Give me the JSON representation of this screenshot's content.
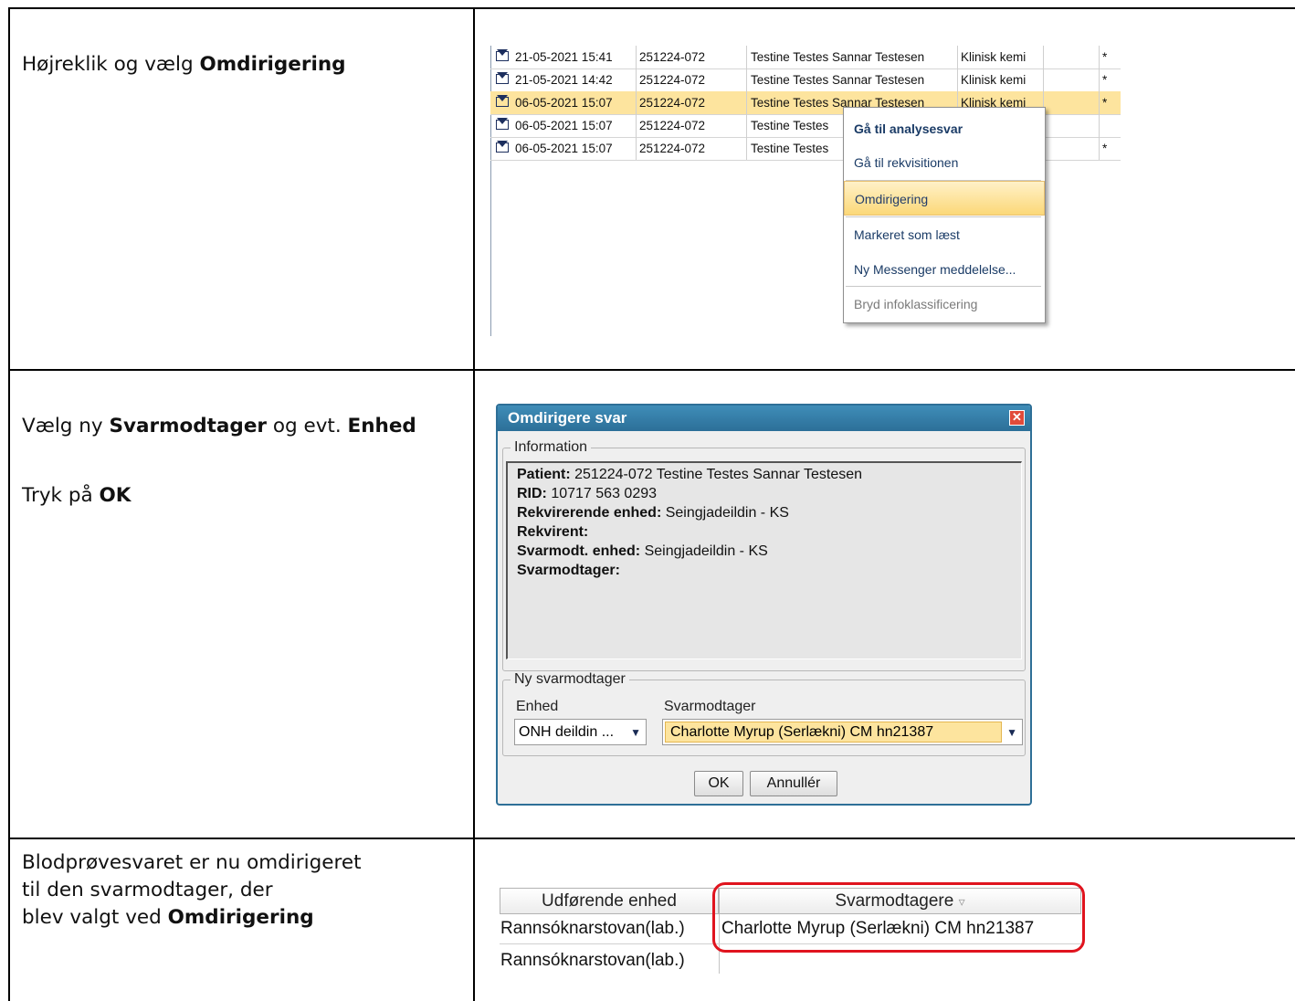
{
  "step1": {
    "text": "Højreklik og vælg ",
    "bold": "Omdirigering"
  },
  "step2": {
    "line1_a": "Vælg ny ",
    "line1_b": "Svarmodtager",
    "line1_c": " og evt. ",
    "line1_d": "Enhed",
    "line2_a": "Tryk på ",
    "line2_b": "OK"
  },
  "step3": {
    "line1": "Blodprøvesvaret er nu omdirigeret",
    "line2": "til den svarmodtager, der",
    "line3_a": "blev valgt ved ",
    "line3_b": "Omdirigering"
  },
  "list": {
    "rows": [
      {
        "date": "21-05-2021 15:41",
        "id": "251224-072",
        "name": "Testine Testes Sannar Testesen",
        "dept": "Klinisk kemi",
        "star": "*"
      },
      {
        "date": "21-05-2021 14:42",
        "id": "251224-072",
        "name": "Testine Testes Sannar Testesen",
        "dept": "Klinisk kemi",
        "star": "*"
      },
      {
        "date": "06-05-2021 15:07",
        "id": "251224-072",
        "name": "Testine Testes Sannar Testesen",
        "dept": "Klinisk kemi",
        "star": "*"
      },
      {
        "date": "06-05-2021 15:07",
        "id": "251224-072",
        "name": "Testine Testes",
        "dept": "",
        "star": ""
      },
      {
        "date": "06-05-2021 15:07",
        "id": "251224-072",
        "name": "Testine Testes",
        "dept": "",
        "star": "*"
      }
    ]
  },
  "context_menu": {
    "items": [
      "Gå til analysesvar",
      "Gå til rekvisitionen",
      "Omdirigering",
      "Markeret som læst",
      "Ny Messenger meddelelse...",
      "Bryd infoklassificering"
    ]
  },
  "dialog": {
    "title": "Omdirigere svar",
    "info_legend": "Information",
    "patient_label": "Patient:",
    "patient_value": " 251224-072  Testine Testes Sannar Testesen",
    "rid_label": "RID:",
    "rid_value": " 10717 563 0293",
    "rekv_enhed_label": "Rekvirerende enhed:",
    "rekv_enhed_value": " Seingjadeildin - KS",
    "rekvirent_label": "Rekvirent:",
    "svar_enhed_label": "Svarmodt. enhed:",
    "svar_enhed_value": " Seingjadeildin - KS",
    "svarmodtager_label": "Svarmodtager:",
    "new_legend": "Ny svarmodtager",
    "enhed_label": "Enhed",
    "enhed_value": "ONH deildin ...",
    "svarmodtager_field_label": "Svarmodtager",
    "svarmodtager_value": "Charlotte Myrup (Serlækni) CM hn21387",
    "ok": "OK",
    "cancel": "Annullér"
  },
  "grid": {
    "col1_header": "Udførende enhed",
    "col2_header": "Svarmodtagere",
    "rows": [
      {
        "unit": "Rannsóknarstovan(lab.)",
        "recipient": "Charlotte Myrup (Serlækni) CM hn21387"
      },
      {
        "unit": "Rannsóknarstovan(lab.)",
        "recipient": ""
      }
    ]
  }
}
